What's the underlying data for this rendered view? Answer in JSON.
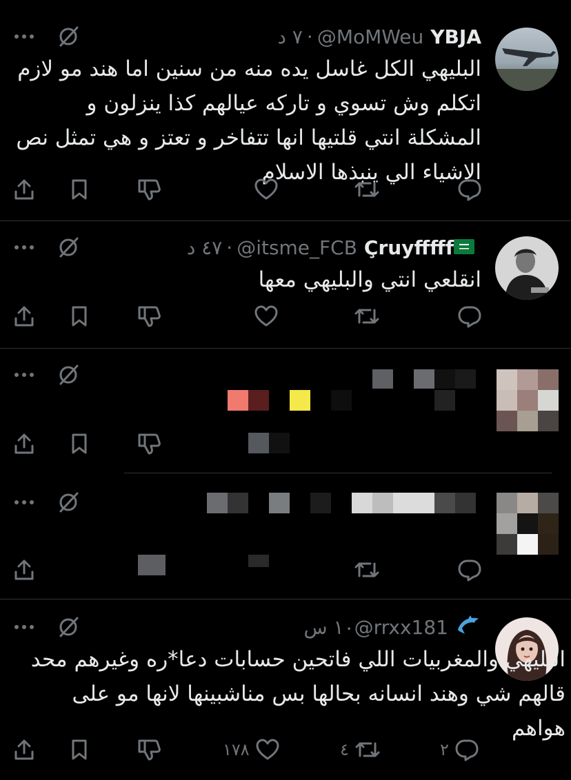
{
  "replies": [
    {
      "name": "YBJA",
      "handle": "@MoMWeu",
      "time": "٧ د",
      "text": "البليهي الكل غاسل يده منه من سنين اما هند مو لازم اتكلم وش تسوي و تاركه عيالهم كذا ينزلون و المشكلة انتي قلتيها انها تتفاخر و تعتز و هي تمثل نص الاشياء الي ينبذها الاسلام",
      "avatar_icon": "airplane-photo"
    },
    {
      "name": "Çruyfffff",
      "handle": "@itsme_FCB",
      "time": "٤٧ د",
      "flag_icon": "saudi-flag-icon",
      "text": "انقلعي انتي والبليهي معها",
      "avatar_icon": "bw-portrait"
    },
    {
      "hidden": true
    },
    {
      "hidden": true
    },
    {
      "name": "",
      "handle": "@rrxx181",
      "time": "١٠ س",
      "name_icon": "dolphin-icon",
      "text": "البليهي والمغربيات اللي فاتحين حسابات دعا*ره وغيرهم محد قالهم شي وهند انسانه بحالها بس مناشبينها لانها مو على هواهم",
      "avatar_icon": "illustrated-girl",
      "counts": {
        "reply": "٢",
        "retweet": "٤",
        "like": "١٧٨"
      }
    }
  ],
  "colors": {
    "background": "#000000",
    "text": "#e7e9ea",
    "muted": "#71767b",
    "separator": "#2f3336"
  }
}
